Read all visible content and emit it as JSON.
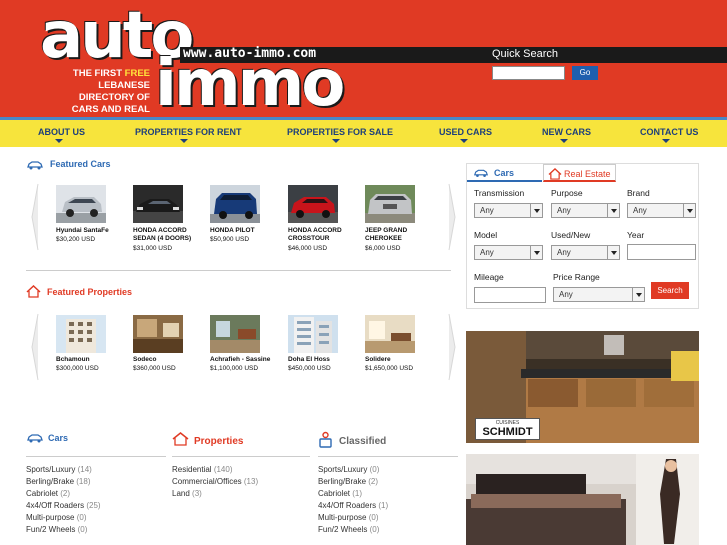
{
  "header": {
    "logo_top": "auto",
    "logo_bottom": "immo",
    "url": "www.auto-immo.com",
    "tagline_1": "THE FIRST ",
    "tagline_free": "FREE",
    "tagline_2": "LEBANESE DIRECTORY OF",
    "tagline_3": "CARS AND REAL ESTATE",
    "quick_search_label": "Quick Search",
    "go_label": "Go"
  },
  "nav": [
    {
      "label": "ABOUT US"
    },
    {
      "label": "PROPERTIES FOR RENT"
    },
    {
      "label": "PROPERTIES FOR SALE"
    },
    {
      "label": "USED CARS"
    },
    {
      "label": "NEW CARS"
    },
    {
      "label": "CONTACT US"
    }
  ],
  "featured_cars": {
    "title": "Featured Cars",
    "items": [
      {
        "title": "Hyundai SantaFe",
        "price": "$30,200 USD"
      },
      {
        "title": "HONDA ACCORD SEDAN (4 DOORS)",
        "price": "$31,000 USD"
      },
      {
        "title": "HONDA PILOT",
        "price": "$50,900 USD"
      },
      {
        "title": "HONDA ACCORD CROSSTOUR",
        "price": "$46,000 USD"
      },
      {
        "title": "JEEP GRAND CHEROKEE",
        "price": "$6,000 USD"
      }
    ]
  },
  "featured_properties": {
    "title": "Featured Properties",
    "items": [
      {
        "title": "Bchamoun",
        "price": "$300,000 USD"
      },
      {
        "title": "Sodeco",
        "price": "$360,000 USD"
      },
      {
        "title": "Achrafieh - Sassine",
        "price": "$1,100,000 USD"
      },
      {
        "title": "Doha El Hoss",
        "price": "$450,000 USD"
      },
      {
        "title": "Solidere",
        "price": "$1,650,000 USD"
      }
    ]
  },
  "lists": {
    "cars": {
      "title": "Cars",
      "items": [
        {
          "label": "Sports/Luxury",
          "count": "(14)"
        },
        {
          "label": "Berling/Brake",
          "count": "(18)"
        },
        {
          "label": "Cabriolet",
          "count": "(2)"
        },
        {
          "label": "4x4/Off Roaders",
          "count": "(25)"
        },
        {
          "label": "Multi-purpose",
          "count": "(0)"
        },
        {
          "label": "Fun/2 Wheels",
          "count": "(0)"
        }
      ]
    },
    "properties": {
      "title": "Properties",
      "items": [
        {
          "label": "Residential",
          "count": "(140)"
        },
        {
          "label": "Commercial/Offices",
          "count": "(13)"
        },
        {
          "label": "Land",
          "count": "(3)"
        }
      ]
    },
    "classified": {
      "title": "Classified",
      "items": [
        {
          "label": "Sports/Luxury",
          "count": "(0)"
        },
        {
          "label": "Berling/Brake",
          "count": "(2)"
        },
        {
          "label": "Cabriolet",
          "count": "(1)"
        },
        {
          "label": "4x4/Off Roaders",
          "count": "(1)"
        },
        {
          "label": "Multi-purpose",
          "count": "(0)"
        },
        {
          "label": "Fun/2 Wheels",
          "count": "(0)"
        }
      ]
    }
  },
  "search_panel": {
    "tab_cars": "Cars",
    "tab_real_estate": "Real Estate",
    "transmission_label": "Transmission",
    "purpose_label": "Purpose",
    "brand_label": "Brand",
    "model_label": "Model",
    "used_new_label": "Used/New",
    "year_label": "Year",
    "mileage_label": "Mileage",
    "price_range_label": "Price Range",
    "any": "Any",
    "search_label": "Search"
  },
  "ads": {
    "kitchen_brand_top": "CUISINES",
    "kitchen_brand": "SCHMIDT"
  },
  "colors": {
    "brand_red": "#e03a24",
    "nav_yellow": "#f7e43c",
    "link_blue": "#2e6ab3"
  }
}
